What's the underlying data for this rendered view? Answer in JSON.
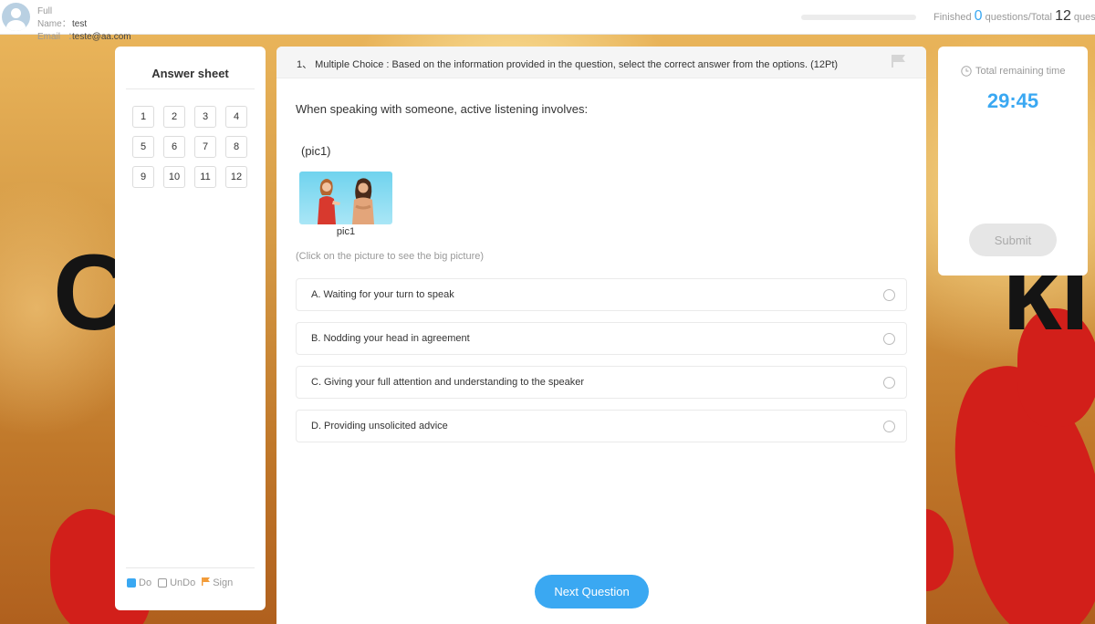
{
  "user": {
    "name_label": "Full Name",
    "name_sep": "：",
    "name_value": "test",
    "email_label": "Email",
    "email_sep": "：",
    "email_value": "teste@aa.com"
  },
  "progress": {
    "finished_label": "Finished",
    "finished_count": "0",
    "questions_total_label": "questions/Total",
    "total_count": "12",
    "total_suffix": "quest",
    "fraction_complete": 0
  },
  "answer_sheet": {
    "title": "Answer sheet",
    "questions": [
      "1",
      "2",
      "3",
      "4",
      "5",
      "6",
      "7",
      "8",
      "9",
      "10",
      "11",
      "12"
    ],
    "legend": {
      "do": "Do",
      "undo": "UnDo",
      "sign": "Sign"
    }
  },
  "question": {
    "header": "1、 Multiple Choice : Based on the information provided in the question, select the correct answer from the options. (12Pt)",
    "stem": "When speaking with someone, active listening involves:",
    "picture_label": "(pic1)",
    "picture_caption": "pic1",
    "hint": "(Click on the picture to see the big picture)",
    "options": [
      "A. Waiting for your turn to speak",
      "B. Nodding your head in agreement",
      "C. Giving your full attention and understanding to the speaker",
      "D. Providing unsolicited advice"
    ],
    "next_label": "Next Question"
  },
  "timer": {
    "label": "Total remaining time",
    "value": "29:45",
    "submit_label": "Submit"
  },
  "colors": {
    "accent": "#3aa8f2",
    "sign_flag": "#f29b38"
  },
  "icons": {
    "avatar": "user-avatar-icon",
    "flag": "flag-icon",
    "clock": "clock-icon"
  }
}
